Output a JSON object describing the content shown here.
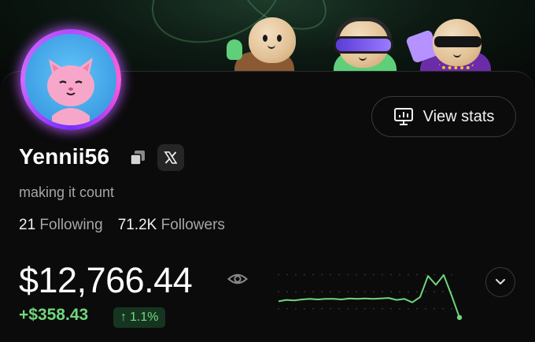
{
  "profile": {
    "username": "Yennii56",
    "bio": "making it count",
    "following_count": "21",
    "following_label": "Following",
    "followers_count": "71.2K",
    "followers_label": "Followers"
  },
  "actions": {
    "view_stats_label": "View stats"
  },
  "portfolio": {
    "balance": "$12,766.44",
    "change_amount": "+$358.43",
    "change_percent": "1.1%",
    "change_arrow": "↑"
  },
  "chart_data": {
    "type": "line",
    "x": [
      0,
      1,
      2,
      3,
      4,
      5,
      6,
      7,
      8,
      9,
      10,
      11,
      12,
      13,
      14,
      15,
      16,
      17,
      18,
      19,
      20,
      21,
      22,
      23
    ],
    "series": [
      {
        "values": [
          38,
          41,
          40,
          42,
          43,
          42,
          43,
          43,
          42,
          44,
          43,
          44,
          43,
          44,
          45,
          41,
          43,
          36,
          47,
          90,
          72,
          92,
          50,
          5
        ]
      }
    ],
    "ylim": [
      0,
      100
    ],
    "grid": true
  },
  "colors": {
    "accent_green": "#6fd67c",
    "badge_bg": "#163520",
    "avatar_glow": "#b44bff"
  },
  "icons": {
    "copy": "copy-icon",
    "x_logo": "x-logo-icon",
    "stats": "presentation-chart-icon",
    "visibility": "eye-icon",
    "expand": "chevron-down-icon"
  }
}
